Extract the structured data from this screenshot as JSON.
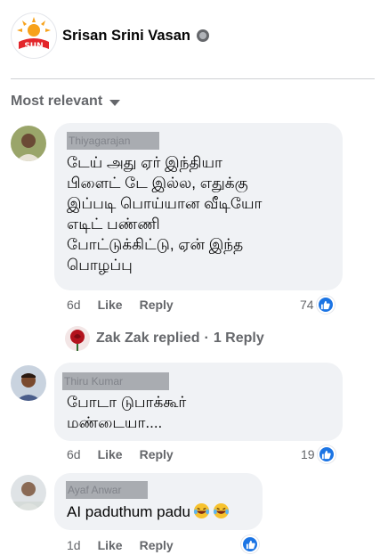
{
  "post": {
    "page_name": "Srisan Srini Vasan",
    "audience_icon": "globe-icon",
    "logo_text": "SUN"
  },
  "sort": {
    "label": "Most relevant",
    "icon": "chevron-down-icon"
  },
  "comments": [
    {
      "author": "Thiyagarajan",
      "text": "டேய் அது ஏர் இந்தியா\nபிளைட் டே இல்ல, எதுக்கு\nஇப்படி பொய்யான வீடியோ\nஎடிட் பண்ணி\nபோட்டுக்கிட்டு, ஏன் இந்த\nபொழப்பு",
      "age": "6d",
      "like_label": "Like",
      "reply_label": "Reply",
      "reaction_count": "74",
      "replies": {
        "replier": "Zak Zak replied",
        "count_label": "1 Reply"
      }
    },
    {
      "author": "Thiru Kumar",
      "text": "போடா டுபாக்கூர்\nமண்டையா....",
      "age": "6d",
      "like_label": "Like",
      "reply_label": "Reply",
      "reaction_count": "19"
    },
    {
      "author": "Ayaf Anwar",
      "text": "AI paduthum padu",
      "age": "1d",
      "like_label": "Like",
      "reply_label": "Reply",
      "reaction_count": ""
    }
  ],
  "colors": {
    "reaction_blue": "#1b74e4",
    "bubble": "#f0f2f5",
    "meta_grey": "#65676b"
  }
}
